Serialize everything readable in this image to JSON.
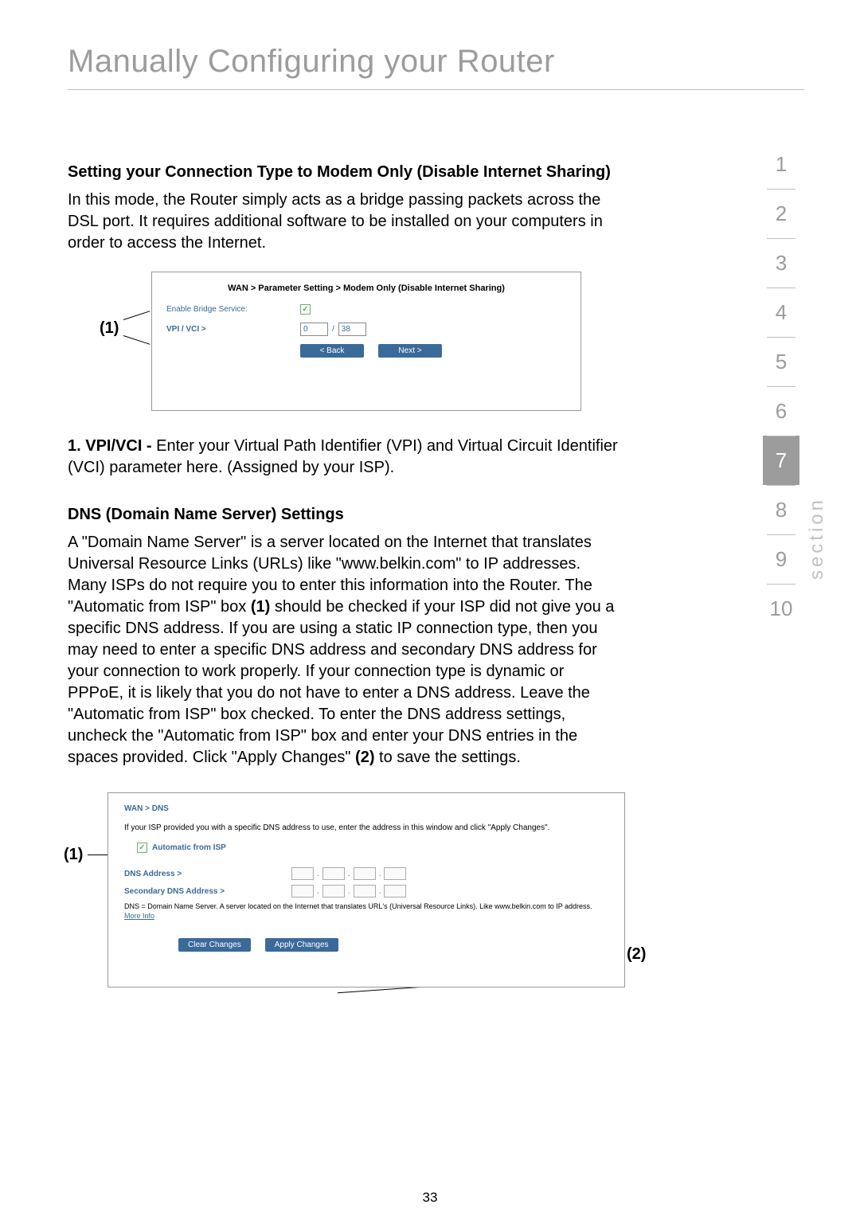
{
  "page": {
    "title": "Manually Configuring your Router",
    "page_number": "33"
  },
  "section_nav": {
    "label": "section",
    "items": [
      "1",
      "2",
      "3",
      "4",
      "5",
      "6",
      "7",
      "8",
      "9",
      "10"
    ],
    "active": "7"
  },
  "content": {
    "heading1": "Setting your Connection Type to Modem Only (Disable Internet Sharing)",
    "para1": "In this mode, the Router simply acts as a bridge passing packets across the DSL port. It requires additional software to be installed on your computers in order to access the Internet.",
    "callout1": "(1)",
    "scr1": {
      "breadcrumb": "WAN > Parameter Setting > Modem Only (Disable Internet Sharing)",
      "enable_bridge_label": "Enable Bridge Service:",
      "vpi_vci_label": "VPI / VCI >",
      "vpi_value": "0",
      "vci_value": "38",
      "slash": "/",
      "back_btn": "< Back",
      "next_btn": "Next >"
    },
    "list1_label": "1. VPI/VCI -",
    "list1_text": " Enter your Virtual Path Identifier (VPI) and Virtual Circuit Identifier (VCI) parameter here. (Assigned by your ISP).",
    "heading2": "DNS (Domain Name Server) Settings",
    "para2a": "A \"Domain Name Server\" is a server located on the Internet that translates Universal Resource Links (URLs) like \"www.belkin.com\" to IP addresses. Many ISPs do not require you to enter this information into the Router. The \"Automatic from ISP\" box ",
    "para2b": "(1)",
    "para2c": " should be checked if your ISP did not give you a specific DNS address. If you are using a static IP connection type, then you may need to enter a specific DNS address and secondary DNS address for your connection to work properly. If your connection type is dynamic or PPPoE, it is likely that you do not have to enter a DNS address. Leave the \"Automatic from ISP\" box checked. To enter the DNS address settings, uncheck the \"Automatic from ISP\" box and enter your DNS entries in the spaces provided. Click \"Apply Changes\" ",
    "para2d": "(2)",
    "para2e": " to save the settings.",
    "callout2_left": "(1)",
    "callout2_right": "(2)",
    "scr2": {
      "breadcrumb": "WAN > DNS",
      "intro": "If your ISP provided you with a specific DNS address to use, enter the address in this window and click \"Apply Changes\".",
      "auto_label": "Automatic from ISP",
      "dns_label": "DNS Address >",
      "sec_dns_label": "Secondary DNS Address >",
      "note_a": "DNS = Domain Name Server. A server located on the Internet that translates URL's (Universal Resource Links). Like www.belkin.com to IP address. ",
      "note_link": "More Info",
      "clear_btn": "Clear Changes",
      "apply_btn": "Apply Changes"
    }
  }
}
